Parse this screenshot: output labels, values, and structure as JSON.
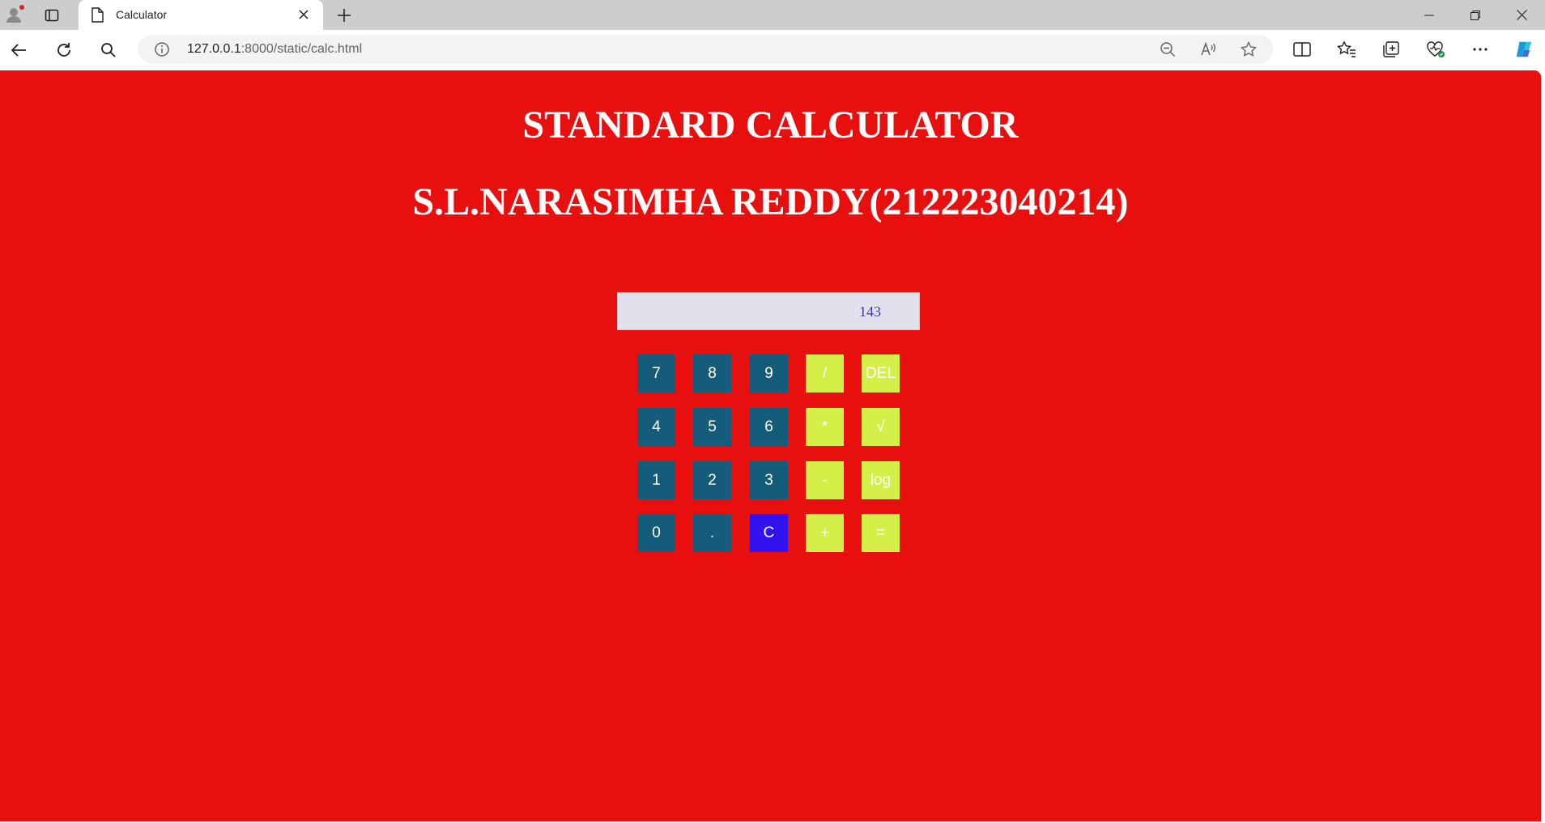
{
  "browser": {
    "tab_title": "Calculator",
    "url_host": "127.0.0.1",
    "url_rest": ":8000/static/calc.html"
  },
  "page": {
    "title": "STANDARD CALCULATOR",
    "subtitle": "S.L.NARASIMHA REDDY(212223040214)",
    "background": "#e80f0f"
  },
  "calculator": {
    "display_value": "143",
    "colors": {
      "number_key": "#155c7a",
      "operator_key": "#d4f048",
      "clear_key": "#3212f0",
      "display": "#e2e0ec"
    },
    "keys": [
      [
        "7",
        "8",
        "9",
        "/",
        "DEL"
      ],
      [
        "4",
        "5",
        "6",
        "*",
        "√"
      ],
      [
        "1",
        "2",
        "3",
        "-",
        "log"
      ],
      [
        "0",
        ".",
        "C",
        "+",
        "="
      ]
    ]
  }
}
